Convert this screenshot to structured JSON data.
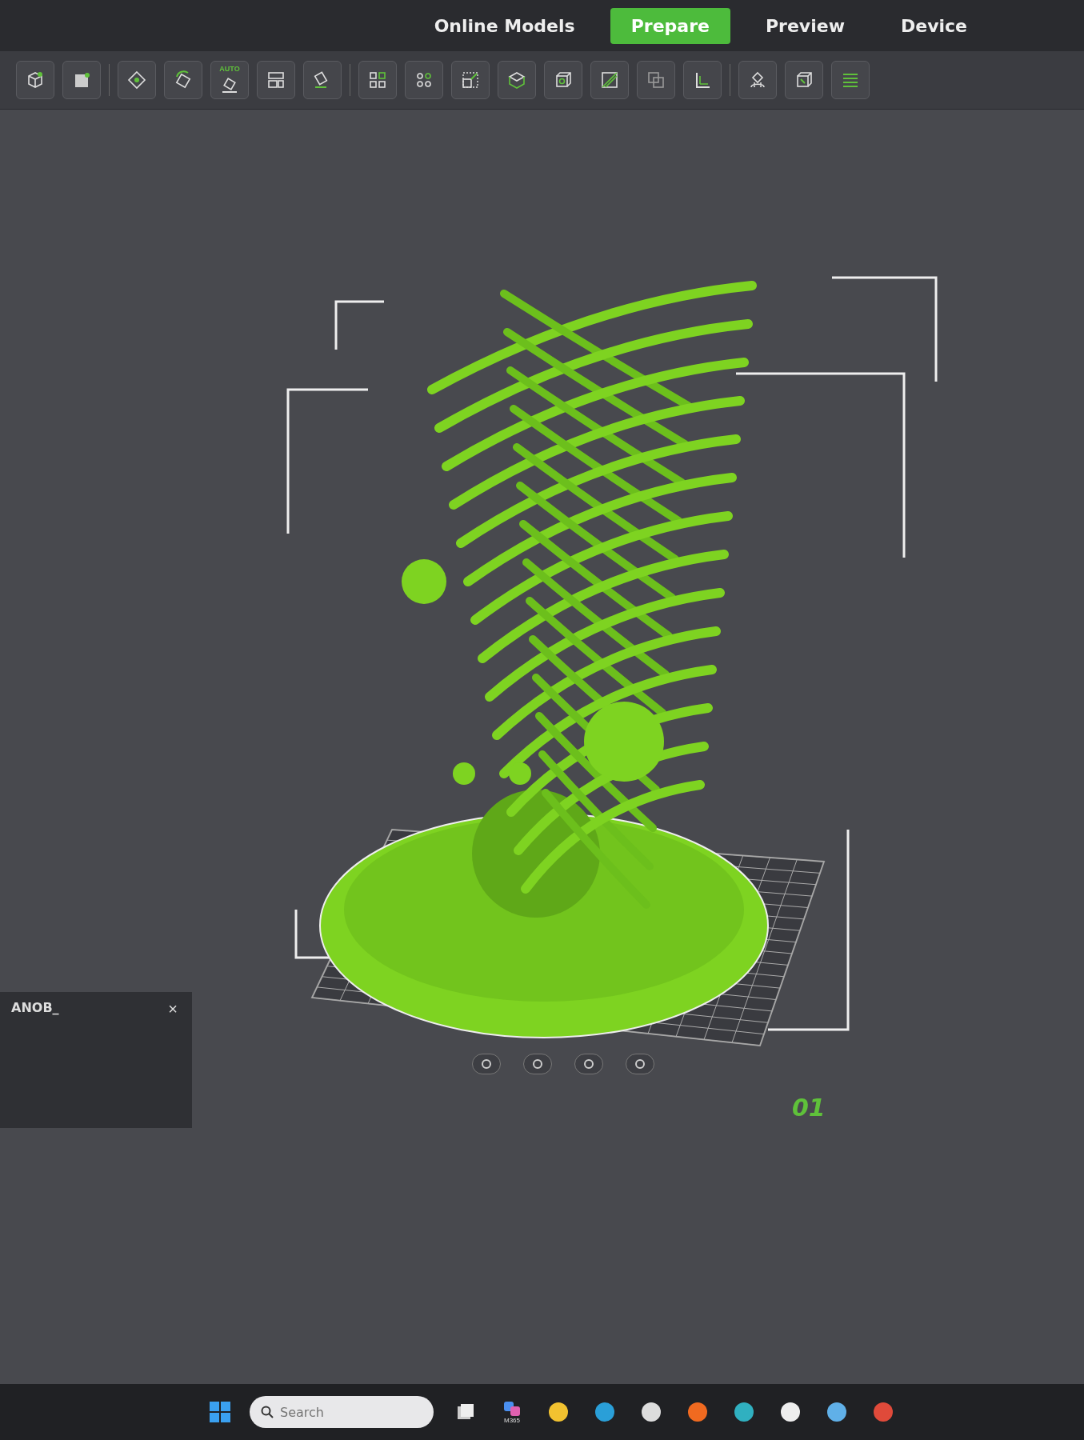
{
  "tabs": [
    {
      "label": "Online Models",
      "selected": false
    },
    {
      "label": "Prepare",
      "selected": true
    },
    {
      "label": "Preview",
      "selected": false
    },
    {
      "label": "Device",
      "selected": false
    }
  ],
  "toolbar": {
    "auto_label": "AUTO"
  },
  "side_panel": {
    "title": "ANOB_",
    "close": "×"
  },
  "plate": {
    "number": "01"
  },
  "taskbar": {
    "search": {
      "placeholder": "Search"
    },
    "app_label": "M365"
  }
}
